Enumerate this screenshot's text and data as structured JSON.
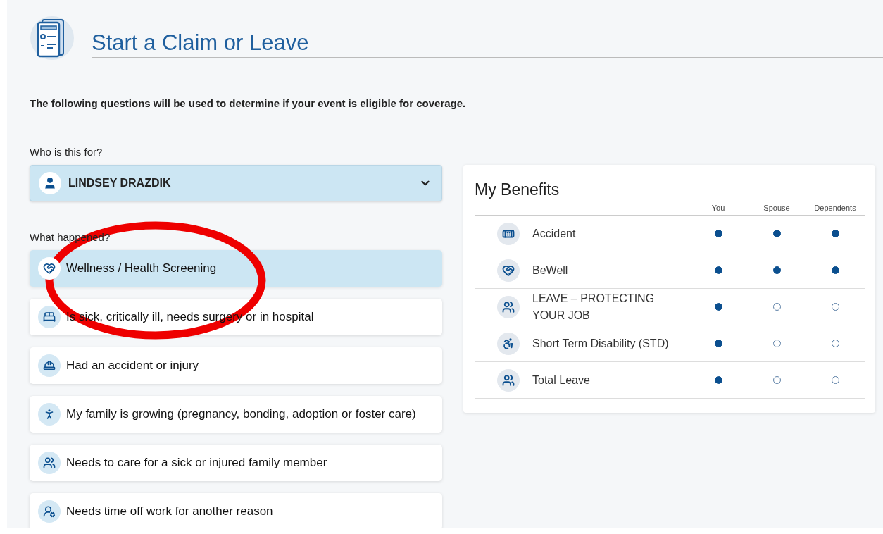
{
  "header": {
    "title": "Start a Claim or Leave"
  },
  "intro": "The following questions will be used to determine if your event is eligible for coverage.",
  "who": {
    "label": "Who is this for?",
    "value": "LINDSEY DRAZDIK"
  },
  "what": {
    "label": "What happened?",
    "options": [
      {
        "label": "Wellness / Health Screening",
        "selected": true
      },
      {
        "label": "Is sick, critically ill, needs surgery or in hospital",
        "selected": false
      },
      {
        "label": "Had an accident or injury",
        "selected": false
      },
      {
        "label": "My family is growing (pregnancy, bonding, adoption or foster care)",
        "selected": false
      },
      {
        "label": "Needs to care for a sick or injured family member",
        "selected": false
      },
      {
        "label": "Needs time off work for another reason",
        "selected": false
      }
    ]
  },
  "benefits": {
    "title": "My Benefits",
    "columns": [
      "You",
      "Spouse",
      "Dependents"
    ],
    "rows": [
      {
        "name": "Accident",
        "coverage": [
          true,
          true,
          true
        ]
      },
      {
        "name": "BeWell",
        "coverage": [
          true,
          true,
          true
        ]
      },
      {
        "name": "LEAVE – PROTECTING YOUR JOB",
        "coverage": [
          true,
          false,
          false
        ]
      },
      {
        "name": "Short Term Disability (STD)",
        "coverage": [
          true,
          false,
          false
        ]
      },
      {
        "name": "Total Leave",
        "coverage": [
          true,
          false,
          false
        ]
      }
    ]
  }
}
